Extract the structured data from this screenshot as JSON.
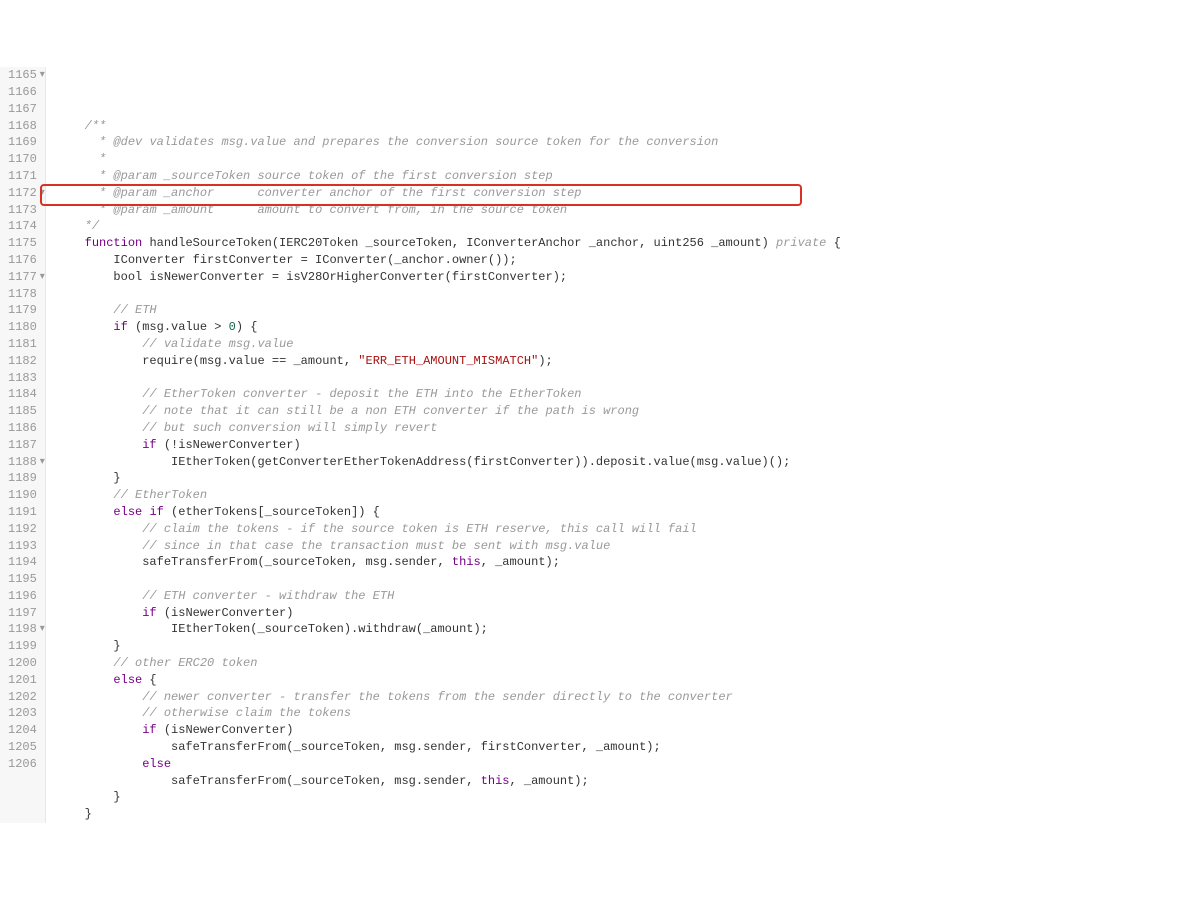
{
  "startLine": 1165,
  "foldLines": [
    1165,
    1172,
    1177,
    1188,
    1198
  ],
  "highlightedLine": 1172,
  "lines": [
    {
      "n": 1165,
      "spans": [
        [
          "    ",
          "plain"
        ],
        [
          "/**",
          "c-comment"
        ]
      ]
    },
    {
      "n": 1166,
      "spans": [
        [
          "      ",
          "plain"
        ],
        [
          "* @dev validates msg.value and prepares the conversion source token for the conversion",
          "c-comment"
        ]
      ]
    },
    {
      "n": 1167,
      "spans": [
        [
          "      ",
          "plain"
        ],
        [
          "*",
          "c-comment"
        ]
      ]
    },
    {
      "n": 1168,
      "spans": [
        [
          "      ",
          "plain"
        ],
        [
          "* @param _sourceToken source token of the first conversion step",
          "c-comment"
        ]
      ]
    },
    {
      "n": 1169,
      "spans": [
        [
          "      ",
          "plain"
        ],
        [
          "* @param _anchor      converter anchor of the first conversion step",
          "c-comment"
        ]
      ]
    },
    {
      "n": 1170,
      "spans": [
        [
          "      ",
          "plain"
        ],
        [
          "* @param _amount      amount to convert from, in the source token",
          "c-comment"
        ]
      ]
    },
    {
      "n": 1171,
      "spans": [
        [
          "    ",
          "plain"
        ],
        [
          "*/",
          "c-comment"
        ]
      ]
    },
    {
      "n": 1172,
      "spans": [
        [
          "    ",
          "plain"
        ],
        [
          "function",
          "c-keyword"
        ],
        [
          " ",
          "plain"
        ],
        [
          "handleSourceToken",
          "c-func"
        ],
        [
          "(IERC20Token _sourceToken, IConverterAnchor _anchor, ",
          "plain"
        ],
        [
          "uint256",
          "c-type"
        ],
        [
          " _amount) ",
          "plain"
        ],
        [
          "private",
          "c-private"
        ],
        [
          " {",
          "plain"
        ]
      ]
    },
    {
      "n": 1173,
      "spans": [
        [
          "        IConverter firstConverter = IConverter(_anchor.owner());",
          "plain"
        ]
      ]
    },
    {
      "n": 1174,
      "spans": [
        [
          "        ",
          "plain"
        ],
        [
          "bool",
          "c-type"
        ],
        [
          " isNewerConverter = isV28OrHigherConverter(firstConverter);",
          "plain"
        ]
      ]
    },
    {
      "n": 1175,
      "spans": [
        [
          "",
          "plain"
        ]
      ]
    },
    {
      "n": 1176,
      "spans": [
        [
          "        ",
          "plain"
        ],
        [
          "// ETH",
          "c-comment"
        ]
      ]
    },
    {
      "n": 1177,
      "spans": [
        [
          "        ",
          "plain"
        ],
        [
          "if",
          "c-keyword"
        ],
        [
          " (msg.value > ",
          "plain"
        ],
        [
          "0",
          "c-number"
        ],
        [
          ") {",
          "plain"
        ]
      ]
    },
    {
      "n": 1178,
      "spans": [
        [
          "            ",
          "plain"
        ],
        [
          "// validate msg.value",
          "c-comment"
        ]
      ]
    },
    {
      "n": 1179,
      "spans": [
        [
          "            ",
          "plain"
        ],
        [
          "require",
          "c-builtin"
        ],
        [
          "(msg.value == _amount, ",
          "plain"
        ],
        [
          "\"ERR_ETH_AMOUNT_MISMATCH\"",
          "c-string"
        ],
        [
          ");",
          "plain"
        ]
      ]
    },
    {
      "n": 1180,
      "spans": [
        [
          "",
          "plain"
        ]
      ]
    },
    {
      "n": 1181,
      "spans": [
        [
          "            ",
          "plain"
        ],
        [
          "// EtherToken converter - deposit the ETH into the EtherToken",
          "c-comment"
        ]
      ]
    },
    {
      "n": 1182,
      "spans": [
        [
          "            ",
          "plain"
        ],
        [
          "// note that it can still be a non ETH converter if the path is wrong",
          "c-comment"
        ]
      ]
    },
    {
      "n": 1183,
      "spans": [
        [
          "            ",
          "plain"
        ],
        [
          "// but such conversion will simply revert",
          "c-comment"
        ]
      ]
    },
    {
      "n": 1184,
      "spans": [
        [
          "            ",
          "plain"
        ],
        [
          "if",
          "c-keyword"
        ],
        [
          " (!isNewerConverter)",
          "plain"
        ]
      ]
    },
    {
      "n": 1185,
      "spans": [
        [
          "                IEtherToken(getConverterEtherTokenAddress(firstConverter)).deposit.value(msg.value)();",
          "plain"
        ]
      ]
    },
    {
      "n": 1186,
      "spans": [
        [
          "        }",
          "plain"
        ]
      ]
    },
    {
      "n": 1187,
      "spans": [
        [
          "        ",
          "plain"
        ],
        [
          "// EtherToken",
          "c-comment"
        ]
      ]
    },
    {
      "n": 1188,
      "spans": [
        [
          "        ",
          "plain"
        ],
        [
          "else",
          "c-keyword"
        ],
        [
          " ",
          "plain"
        ],
        [
          "if",
          "c-keyword"
        ],
        [
          " (etherTokens[_sourceToken]) {",
          "plain"
        ]
      ]
    },
    {
      "n": 1189,
      "spans": [
        [
          "            ",
          "plain"
        ],
        [
          "// claim the tokens - if the source token is ETH reserve, this call will fail",
          "c-comment"
        ]
      ]
    },
    {
      "n": 1190,
      "spans": [
        [
          "            ",
          "plain"
        ],
        [
          "// since in that case the transaction must be sent with msg.value",
          "c-comment"
        ]
      ]
    },
    {
      "n": 1191,
      "spans": [
        [
          "            safeTransferFrom(_sourceToken, msg.sender, ",
          "plain"
        ],
        [
          "this",
          "c-keyword"
        ],
        [
          ", _amount);",
          "plain"
        ]
      ]
    },
    {
      "n": 1192,
      "spans": [
        [
          "",
          "plain"
        ]
      ]
    },
    {
      "n": 1193,
      "spans": [
        [
          "            ",
          "plain"
        ],
        [
          "// ETH converter - withdraw the ETH",
          "c-comment"
        ]
      ]
    },
    {
      "n": 1194,
      "spans": [
        [
          "            ",
          "plain"
        ],
        [
          "if",
          "c-keyword"
        ],
        [
          " (isNewerConverter)",
          "plain"
        ]
      ]
    },
    {
      "n": 1195,
      "spans": [
        [
          "                IEtherToken(_sourceToken).withdraw(_amount);",
          "plain"
        ]
      ]
    },
    {
      "n": 1196,
      "spans": [
        [
          "        }",
          "plain"
        ]
      ]
    },
    {
      "n": 1197,
      "spans": [
        [
          "        ",
          "plain"
        ],
        [
          "// other ERC20 token",
          "c-comment"
        ]
      ]
    },
    {
      "n": 1198,
      "spans": [
        [
          "        ",
          "plain"
        ],
        [
          "else",
          "c-keyword"
        ],
        [
          " {",
          "plain"
        ]
      ]
    },
    {
      "n": 1199,
      "spans": [
        [
          "            ",
          "plain"
        ],
        [
          "// newer converter - transfer the tokens from the sender directly to the converter",
          "c-comment"
        ]
      ]
    },
    {
      "n": 1200,
      "spans": [
        [
          "            ",
          "plain"
        ],
        [
          "// otherwise claim the tokens",
          "c-comment"
        ]
      ]
    },
    {
      "n": 1201,
      "spans": [
        [
          "            ",
          "plain"
        ],
        [
          "if",
          "c-keyword"
        ],
        [
          " (isNewerConverter)",
          "plain"
        ]
      ]
    },
    {
      "n": 1202,
      "spans": [
        [
          "                safeTransferFrom(_sourceToken, msg.sender, firstConverter, _amount);",
          "plain"
        ]
      ]
    },
    {
      "n": 1203,
      "spans": [
        [
          "            ",
          "plain"
        ],
        [
          "else",
          "c-keyword"
        ]
      ]
    },
    {
      "n": 1204,
      "spans": [
        [
          "                safeTransferFrom(_sourceToken, msg.sender, ",
          "plain"
        ],
        [
          "this",
          "c-keyword"
        ],
        [
          ", _amount);",
          "plain"
        ]
      ]
    },
    {
      "n": 1205,
      "spans": [
        [
          "        }",
          "plain"
        ]
      ]
    },
    {
      "n": 1206,
      "spans": [
        [
          "    }",
          "plain"
        ]
      ]
    }
  ]
}
